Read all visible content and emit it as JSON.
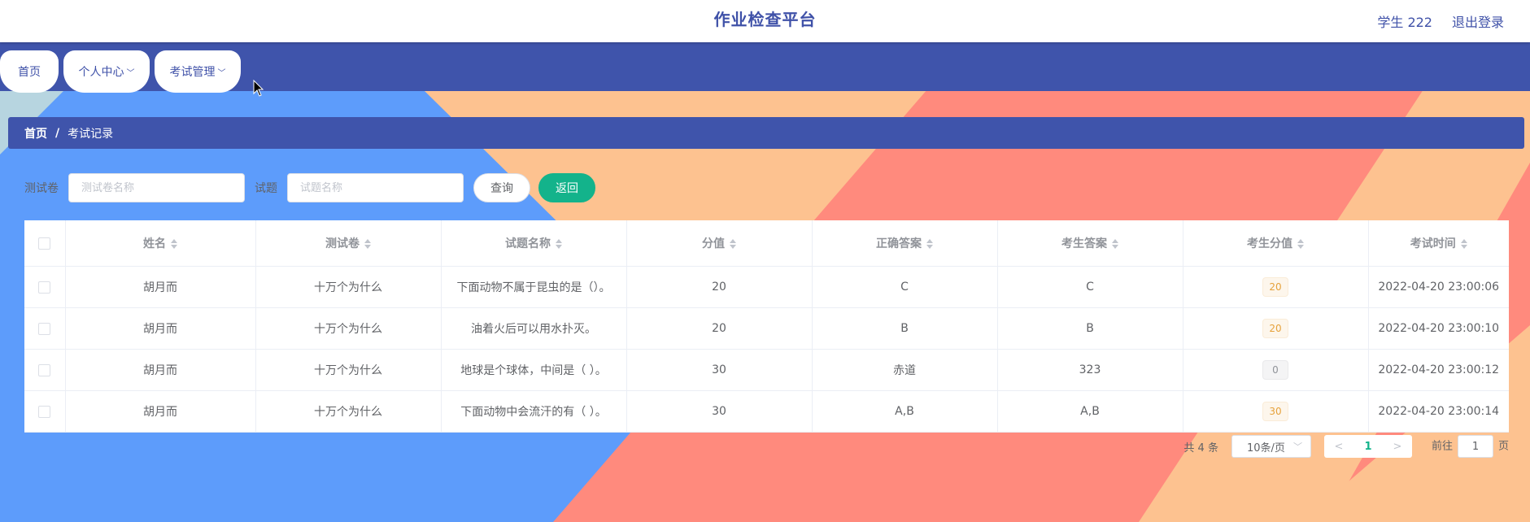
{
  "header": {
    "title": "作业检查平台",
    "user": "学生 222",
    "logout": "退出登录"
  },
  "nav": {
    "home": "首页",
    "personal": "个人中心",
    "exam": "考试管理"
  },
  "breadcrumb": {
    "home": "首页",
    "separator": "/",
    "current": "考试记录"
  },
  "search": {
    "paper_label": "测试卷",
    "paper_placeholder": "测试卷名称",
    "question_label": "试题",
    "question_placeholder": "试题名称",
    "query_button": "查询",
    "back_button": "返回"
  },
  "table": {
    "columns": [
      "姓名",
      "测试卷",
      "试题名称",
      "分值",
      "正确答案",
      "考生答案",
      "考生分值",
      "考试时间"
    ],
    "rows": [
      {
        "name": "胡月而",
        "paper": "十万个为什么",
        "question": "下面动物不属于昆虫的是（）。",
        "score": "20",
        "correct": "C",
        "answer": "C",
        "got": "20",
        "time": "2022-04-20 23:00:06"
      },
      {
        "name": "胡月而",
        "paper": "十万个为什么",
        "question": "油着火后可以用水扑灭。",
        "score": "20",
        "correct": "B",
        "answer": "B",
        "got": "20",
        "time": "2022-04-20 23:00:10"
      },
      {
        "name": "胡月而",
        "paper": "十万个为什么",
        "question": "地球是个球体，中间是（ ）。",
        "score": "30",
        "correct": "赤道",
        "answer": "323",
        "got": "0",
        "time": "2022-04-20 23:00:12"
      },
      {
        "name": "胡月而",
        "paper": "十万个为什么",
        "question": "下面动物中会流汗的有（ ）。",
        "score": "30",
        "correct": "A,B",
        "answer": "A,B",
        "got": "30",
        "time": "2022-04-20 23:00:14"
      }
    ]
  },
  "pagination": {
    "total": "共 4 条",
    "page_size": "10条/页",
    "prev": "<",
    "current": "1",
    "next": ">",
    "goto_prefix": "前往",
    "goto_value": "1",
    "goto_suffix": "页"
  },
  "colors": {
    "primary": "#3f54ab",
    "accent": "#13b38b",
    "bg_blue": "#5d9cfb",
    "bg_peach": "#fdc290",
    "bg_salmon": "#ff8a7d"
  }
}
